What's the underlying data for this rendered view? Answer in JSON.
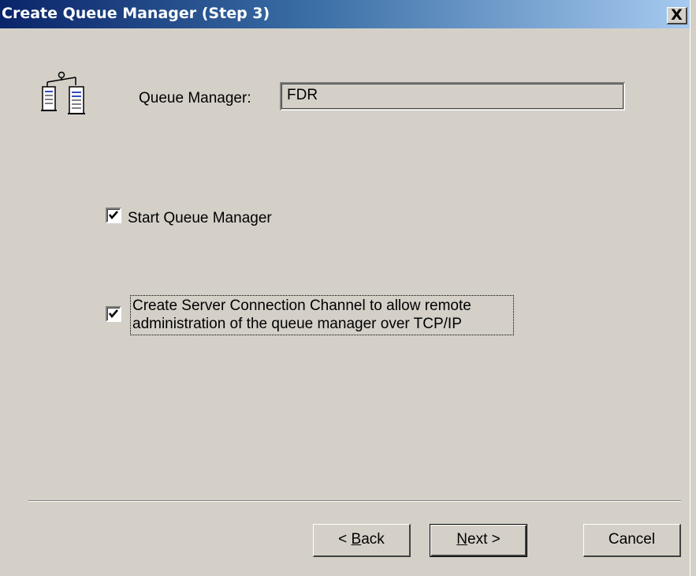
{
  "window": {
    "title": "Create Queue Manager (Step 3)",
    "close_label": "X"
  },
  "form": {
    "queue_manager_label": "Queue Manager:",
    "queue_manager_value": "FDR"
  },
  "options": {
    "start_queue_manager": {
      "label": "Start Queue Manager",
      "checked": true
    },
    "create_server_channel": {
      "label_line1": "Create Server Connection Channel to allow remote",
      "label_line2": "administration of the queue manager over TCP/IP",
      "checked": true
    }
  },
  "buttons": {
    "back_prefix": "< ",
    "back_mnemonic": "B",
    "back_rest": "ack",
    "next_mnemonic": "N",
    "next_rest": "ext >",
    "cancel": "Cancel"
  },
  "icons": {
    "wizard": "queue-manager-wizard-icon",
    "checkmark": "checkmark-icon",
    "close": "close-icon"
  }
}
